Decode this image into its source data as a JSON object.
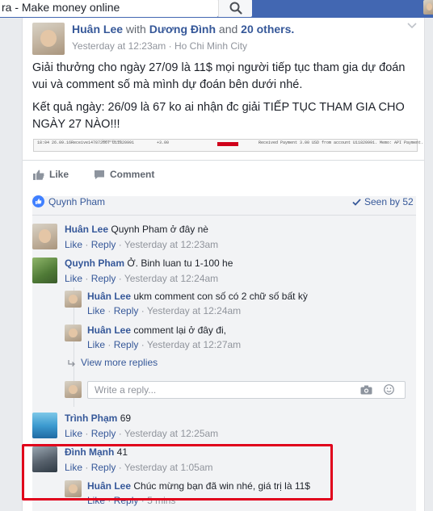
{
  "search": {
    "value": "ra - Make money online"
  },
  "post": {
    "author": "Huân Lee",
    "with_word": "with",
    "tagged": "Dương Đình",
    "and_word": "and",
    "others": "20 others.",
    "time": "Yesterday at 12:23am",
    "separator": "·",
    "location": "Ho Chi Minh City",
    "paragraph1": "Giải thưởng cho ngày 27/09 là 11$ mọi người tiếp tục tham gia dự đoán vui và comment số mà mình dự đoán bên dưới nhé.",
    "paragraph2": "Kết quả ngày: 26/09 là 67 ko ai nhận đc giải TIẾP TỤC THAM GIA CHO NGÀY 27 NÀO!!!",
    "ledger": {
      "date": "18:04 26.09.16",
      "type": "Receive",
      "id": "147872667",
      "account": "U11820991",
      "amount": "+3.00",
      "site": "laravib.me",
      "memo": "Received Payment 3.00 USD from account U11820991. Memo: API Payment."
    }
  },
  "actions": {
    "like": "Like",
    "comment": "Comment"
  },
  "reactions": {
    "liker": "Quynh Pham",
    "seen": "Seen by 52"
  },
  "comments": [
    {
      "name": "Huân Lee",
      "text": "Quynh Pham ở đây nè",
      "like": "Like",
      "reply": "Reply",
      "time": "Yesterday at 12:23am"
    },
    {
      "name": "Quynh Pham",
      "text": "Ở. Binh luan tu 1-100 he",
      "like": "Like",
      "reply": "Reply",
      "time": "Yesterday at 12:24am"
    },
    {
      "name": "Huân Lee",
      "text": "ukm comment con số có 2 chữ số bất kỳ",
      "like": "Like",
      "reply": "Reply",
      "time": "Yesterday at 12:24am"
    },
    {
      "name": "Huân Lee",
      "text": "comment lại ở đây đi,",
      "like": "Like",
      "reply": "Reply",
      "time": "Yesterday at 12:27am"
    },
    {
      "name": "Trình Phạm",
      "text": "69",
      "like": "Like",
      "reply": "Reply",
      "time": "Yesterday at 12:25am"
    },
    {
      "name": "Đình Mạnh",
      "text": "41",
      "like": "Like",
      "reply": "Reply",
      "time": "Yesterday at 1:05am"
    },
    {
      "name": "Huân Lee",
      "text": "Chúc mừng bạn đã win nhé, giá trị là 11$",
      "like": "Like",
      "reply": "Reply",
      "time": "5 mins"
    }
  ],
  "view_more": "View more replies",
  "reply_placeholder": "Write a reply...",
  "dot": "·",
  "colors": {
    "topbar": "#4267b2",
    "link": "#365899",
    "highlight": "#e0001b"
  }
}
